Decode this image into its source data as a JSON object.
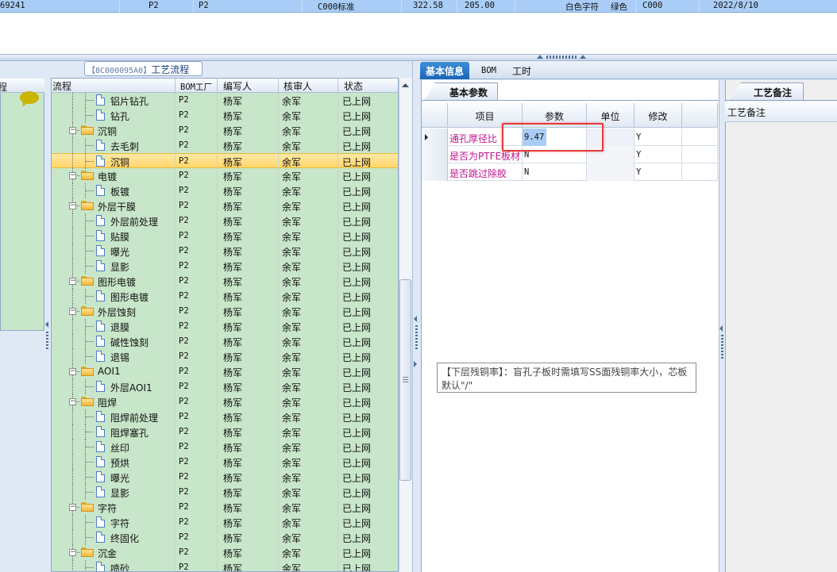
{
  "top_row": {
    "id": "69241",
    "c1": "P2",
    "c2": "P2",
    "standard": "C000标准",
    "v1": "322.58",
    "v2": "205.00",
    "char_color": "白色字符",
    "color": "绿色",
    "code": "C000",
    "date": "2022/8/10"
  },
  "left_panel": {
    "header": "程"
  },
  "process": {
    "title_code": "【8C000095A0】",
    "title_text": "工艺流程",
    "columns": {
      "flow": "流程",
      "factory": "BOM工厂",
      "author": "编写人",
      "reviewer": "核审人",
      "status": "状态"
    },
    "rows": [
      {
        "name": "铝片钻孔",
        "level": 2,
        "factory": "P2",
        "author": "杨军",
        "reviewer": "余军",
        "status": "已上网"
      },
      {
        "name": "钻孔",
        "level": 2,
        "factory": "P2",
        "author": "杨军",
        "reviewer": "余军",
        "status": "已上网"
      },
      {
        "name": "沉铜",
        "level": 1,
        "factory": "P2",
        "author": "杨军",
        "reviewer": "余军",
        "status": "已上网"
      },
      {
        "name": "去毛刺",
        "level": 2,
        "factory": "P2",
        "author": "杨军",
        "reviewer": "余军",
        "status": "已上网"
      },
      {
        "name": "沉铜",
        "level": 2,
        "factory": "P2",
        "author": "杨军",
        "reviewer": "余军",
        "status": "已上网",
        "selected": true
      },
      {
        "name": "电镀",
        "level": 1,
        "factory": "P2",
        "author": "杨军",
        "reviewer": "余军",
        "status": "已上网"
      },
      {
        "name": "板镀",
        "level": 2,
        "factory": "P2",
        "author": "杨军",
        "reviewer": "余军",
        "status": "已上网"
      },
      {
        "name": "外层干膜",
        "level": 1,
        "factory": "P2",
        "author": "杨军",
        "reviewer": "余军",
        "status": "已上网"
      },
      {
        "name": "外层前处理",
        "level": 2,
        "factory": "P2",
        "author": "杨军",
        "reviewer": "余军",
        "status": "已上网"
      },
      {
        "name": "贴膜",
        "level": 2,
        "factory": "P2",
        "author": "杨军",
        "reviewer": "余军",
        "status": "已上网"
      },
      {
        "name": "曝光",
        "level": 2,
        "factory": "P2",
        "author": "杨军",
        "reviewer": "余军",
        "status": "已上网"
      },
      {
        "name": "显影",
        "level": 2,
        "factory": "P2",
        "author": "杨军",
        "reviewer": "余军",
        "status": "已上网"
      },
      {
        "name": "图形电镀",
        "level": 1,
        "factory": "P2",
        "author": "杨军",
        "reviewer": "余军",
        "status": "已上网"
      },
      {
        "name": "图形电镀",
        "level": 2,
        "factory": "P2",
        "author": "杨军",
        "reviewer": "余军",
        "status": "已上网"
      },
      {
        "name": "外层蚀刻",
        "level": 1,
        "factory": "P2",
        "author": "杨军",
        "reviewer": "余军",
        "status": "已上网"
      },
      {
        "name": "退膜",
        "level": 2,
        "factory": "P2",
        "author": "杨军",
        "reviewer": "余军",
        "status": "已上网"
      },
      {
        "name": "碱性蚀刻",
        "level": 2,
        "factory": "P2",
        "author": "杨军",
        "reviewer": "余军",
        "status": "已上网"
      },
      {
        "name": "退锡",
        "level": 2,
        "factory": "P2",
        "author": "杨军",
        "reviewer": "余军",
        "status": "已上网"
      },
      {
        "name": "AOI1",
        "level": 1,
        "factory": "P2",
        "author": "杨军",
        "reviewer": "余军",
        "status": "已上网"
      },
      {
        "name": "外层AOI1",
        "level": 2,
        "factory": "P2",
        "author": "杨军",
        "reviewer": "余军",
        "status": "已上网"
      },
      {
        "name": "阻焊",
        "level": 1,
        "factory": "P2",
        "author": "杨军",
        "reviewer": "余军",
        "status": "已上网"
      },
      {
        "name": "阻焊前处理",
        "level": 2,
        "factory": "P2",
        "author": "杨军",
        "reviewer": "余军",
        "status": "已上网"
      },
      {
        "name": "阻焊塞孔",
        "level": 2,
        "factory": "P2",
        "author": "杨军",
        "reviewer": "余军",
        "status": "已上网"
      },
      {
        "name": "丝印",
        "level": 2,
        "factory": "P2",
        "author": "杨军",
        "reviewer": "余军",
        "status": "已上网"
      },
      {
        "name": "预烘",
        "level": 2,
        "factory": "P2",
        "author": "杨军",
        "reviewer": "余军",
        "status": "已上网"
      },
      {
        "name": "曝光",
        "level": 2,
        "factory": "P2",
        "author": "杨军",
        "reviewer": "余军",
        "status": "已上网"
      },
      {
        "name": "显影",
        "level": 2,
        "factory": "P2",
        "author": "杨军",
        "reviewer": "余军",
        "status": "已上网"
      },
      {
        "name": "字符",
        "level": 1,
        "factory": "P2",
        "author": "杨军",
        "reviewer": "余军",
        "status": "已上网"
      },
      {
        "name": "字符",
        "level": 2,
        "factory": "P2",
        "author": "杨军",
        "reviewer": "余军",
        "status": "已上网"
      },
      {
        "name": "终固化",
        "level": 2,
        "factory": "P2",
        "author": "杨军",
        "reviewer": "余军",
        "status": "已上网"
      },
      {
        "name": "沉金",
        "level": 1,
        "factory": "P2",
        "author": "杨军",
        "reviewer": "余军",
        "status": "已上网"
      },
      {
        "name": "喷砂",
        "level": 2,
        "factory": "P2",
        "author": "杨军",
        "reviewer": "余军",
        "status": "已上网"
      }
    ]
  },
  "tabs": [
    {
      "label": "基本信息",
      "active": true
    },
    {
      "label": "BOM"
    },
    {
      "label": "工时"
    }
  ],
  "params": {
    "subtab": "基本参数",
    "columns": {
      "item": "项目",
      "param": "参数",
      "unit": "单位",
      "modify": "修改"
    },
    "rows": [
      {
        "item": "通孔厚径比",
        "param": "9.47",
        "unit": "",
        "modify": "Y",
        "current": true
      },
      {
        "item": "是否为PTFE板材",
        "param": "N",
        "unit": "",
        "modify": "Y"
      },
      {
        "item": "是否跳过除胶",
        "param": "N",
        "unit": "",
        "modify": "Y"
      }
    ],
    "note": "【下层残铜率】：盲孔子板时需填写SS面残铜率大小，芯板默认\"/\""
  },
  "remarks": {
    "tab": "工艺备注",
    "label": "工艺备注"
  },
  "colors": {
    "tree_bg": "#c8e6c9",
    "selected_row": "#ffd66b",
    "highlight_box": "#e53b3b",
    "active_tab": "#1b66b7",
    "item_text": "#c0148c"
  }
}
